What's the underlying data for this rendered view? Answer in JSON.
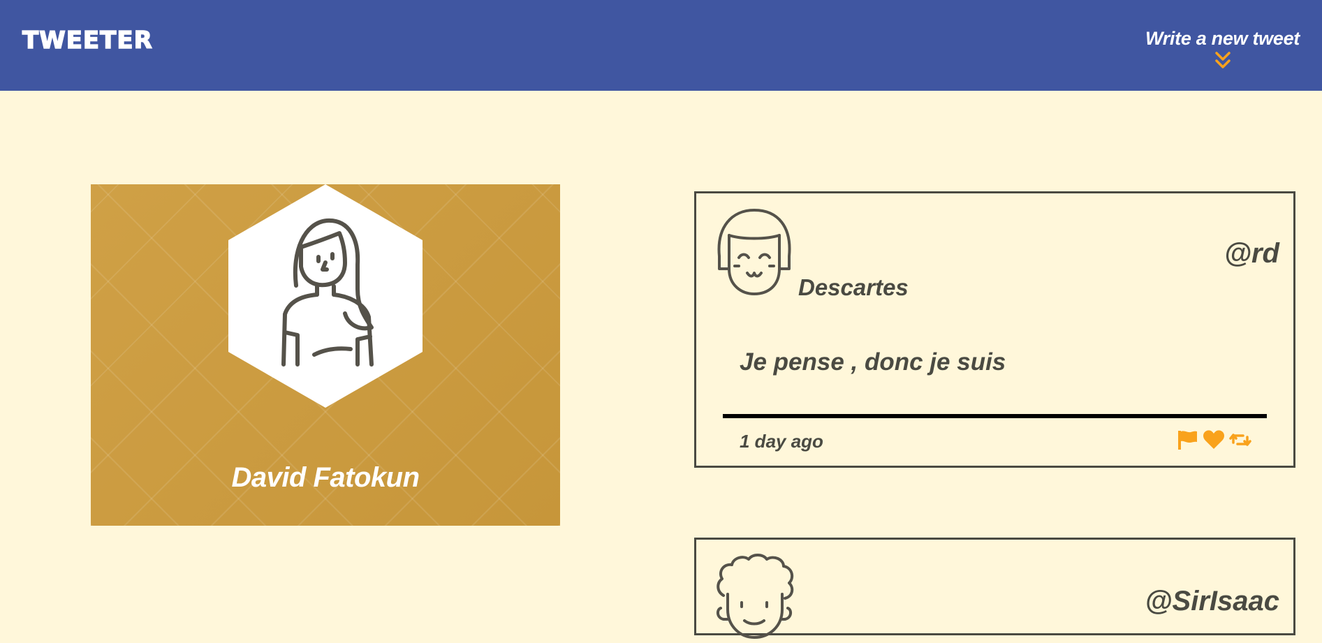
{
  "app": {
    "title": "TWEETER",
    "compose_label": "Write a new tweet",
    "accent_color": "#f9a21c",
    "nav_color": "#4056a1",
    "background_color": "#fff7da"
  },
  "profile": {
    "name": "David Fatokun",
    "card_color": "#cd9b3c"
  },
  "tweets": [
    {
      "name": "Descartes",
      "handle": "@rd",
      "text": "Je pense , donc je suis",
      "time": "1 day ago",
      "actions": [
        "flag-icon",
        "heart-icon",
        "retweet-icon"
      ]
    },
    {
      "name": "",
      "handle": "@SirIsaac",
      "text": "",
      "time": ""
    }
  ]
}
